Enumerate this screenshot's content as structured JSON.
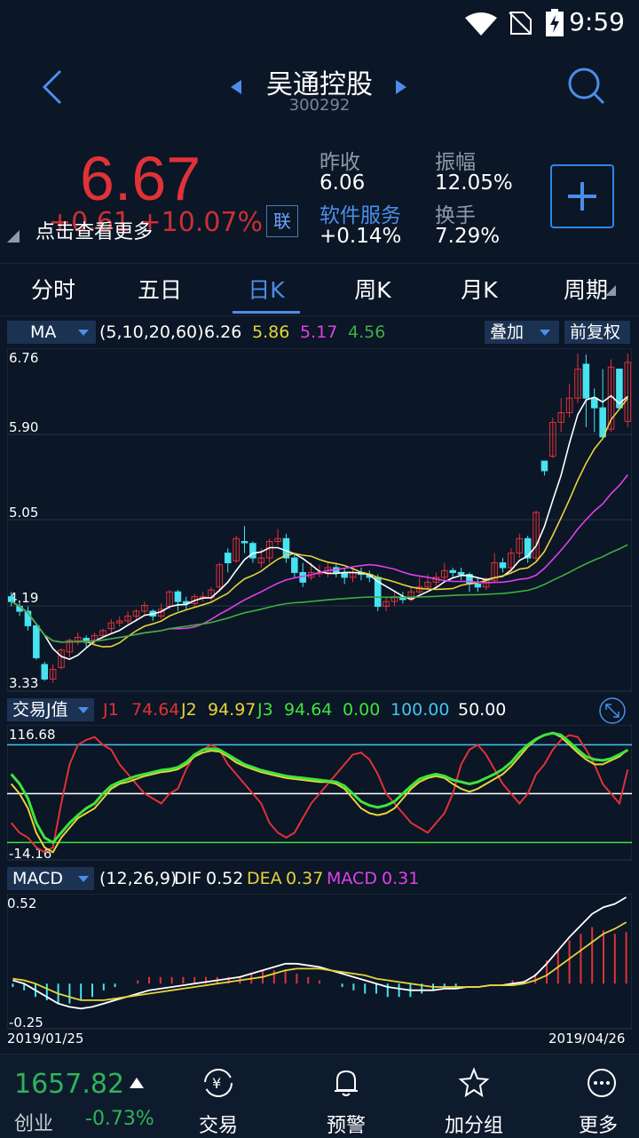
{
  "status": {
    "time": "9:59"
  },
  "header": {
    "title": "吴通控股",
    "code": "300292"
  },
  "quote": {
    "price": "6.67",
    "change": "+0.61  +10.07%",
    "hint": "点击查看更多",
    "lian": "联",
    "prev_close_label": "昨收",
    "prev_close": "6.06",
    "amplitude_label": "振幅",
    "amplitude": "12.05%",
    "sector_label": "软件服务",
    "sector_change": "+0.14%",
    "turnover_label": "换手",
    "turnover": "7.29%"
  },
  "tabs": [
    "分时",
    "五日",
    "日K",
    "周K",
    "月K",
    "周期"
  ],
  "ma": {
    "label": "MA",
    "params": "(5,10,20,60)",
    "v1": "6.26",
    "v2": "5.86",
    "v3": "5.17",
    "v4": "4.56",
    "overlay": "叠加",
    "adjust": "前复权",
    "y_labels": [
      "6.76",
      "5.90",
      "5.05",
      "4.19",
      "3.33"
    ]
  },
  "j": {
    "label": "交易J值",
    "j1_label": "J1",
    "j1": "74.64",
    "j2_label": "J2",
    "j2": "94.97",
    "j3_label": "J3",
    "j3": "94.64",
    "a": "0.00",
    "b": "100.00",
    "c": "50.00",
    "y_top": "116.68",
    "y_bottom": "-14.16"
  },
  "macd": {
    "label": "MACD",
    "params": "(12,26,9)",
    "dif_label": "DIF",
    "dif": "0.52",
    "dea_label": "DEA",
    "dea": "0.37",
    "macd_label": "MACD",
    "macd": "0.31",
    "y_top": "0.52",
    "y_bottom": "-0.25",
    "date_start": "2019/01/25",
    "date_end": "2019/04/26"
  },
  "bottom": {
    "index_value": "1657.82",
    "index_name": "创业",
    "index_change": "-0.73%",
    "trade": "交易",
    "alert": "预警",
    "watchlist": "加分组",
    "more": "更多"
  },
  "colors": {
    "up": "#e03238",
    "down": "#2fb35a",
    "cyan": "#46e3f0",
    "accent": "#4b8ee9"
  },
  "chart_data": [
    {
      "type": "candlestick",
      "title": "",
      "ylim": [
        3.33,
        6.76
      ],
      "candles": [
        [
          4.25,
          4.2,
          4.3,
          4.15
        ],
        [
          4.15,
          4.1,
          4.2,
          4.05
        ],
        [
          4.1,
          3.95,
          4.15,
          3.9
        ],
        [
          3.95,
          3.62,
          3.98,
          3.6
        ],
        [
          3.55,
          3.4,
          3.58,
          3.38
        ],
        [
          3.4,
          3.5,
          3.55,
          3.36
        ],
        [
          3.52,
          3.7,
          3.72,
          3.5
        ],
        [
          3.68,
          3.8,
          3.82,
          3.62
        ],
        [
          3.78,
          3.83,
          3.88,
          3.75
        ],
        [
          3.82,
          3.78,
          3.85,
          3.72
        ],
        [
          3.8,
          3.85,
          3.88,
          3.76
        ],
        [
          3.85,
          3.9,
          3.92,
          3.82
        ],
        [
          3.92,
          3.98,
          4.02,
          3.88
        ],
        [
          3.98,
          4.0,
          4.05,
          3.94
        ],
        [
          4.0,
          4.05,
          4.1,
          3.97
        ],
        [
          4.05,
          4.1,
          4.12,
          4.0
        ],
        [
          4.1,
          4.16,
          4.2,
          4.05
        ],
        [
          4.1,
          4.05,
          4.12,
          4.0
        ],
        [
          4.05,
          4.12,
          4.18,
          4.02
        ],
        [
          4.15,
          4.3,
          4.32,
          4.12
        ],
        [
          4.3,
          4.2,
          4.32,
          4.1
        ],
        [
          4.2,
          4.18,
          4.25,
          4.12
        ],
        [
          4.18,
          4.25,
          4.28,
          4.15
        ],
        [
          4.25,
          4.25,
          4.3,
          4.2
        ],
        [
          4.24,
          4.32,
          4.35,
          4.2
        ],
        [
          4.35,
          4.58,
          4.6,
          4.3
        ],
        [
          4.7,
          4.6,
          4.75,
          4.5
        ],
        [
          4.62,
          4.85,
          4.88,
          4.6
        ],
        [
          4.82,
          4.81,
          4.98,
          4.7
        ],
        [
          4.8,
          4.65,
          4.82,
          4.6
        ],
        [
          4.6,
          4.65,
          4.75,
          4.55
        ],
        [
          4.65,
          4.82,
          4.85,
          4.6
        ],
        [
          4.82,
          4.85,
          4.95,
          4.78
        ],
        [
          4.85,
          4.65,
          4.9,
          4.6
        ],
        [
          4.65,
          4.5,
          4.7,
          4.45
        ],
        [
          4.5,
          4.4,
          4.6,
          4.35
        ],
        [
          4.45,
          4.5,
          4.6,
          4.42
        ],
        [
          4.5,
          4.5,
          4.58,
          4.45
        ],
        [
          4.5,
          4.55,
          4.6,
          4.45
        ],
        [
          4.55,
          4.5,
          4.6,
          4.45
        ],
        [
          4.5,
          4.45,
          4.55,
          4.38
        ],
        [
          4.45,
          4.5,
          4.55,
          4.4
        ],
        [
          4.5,
          4.48,
          4.55,
          4.42
        ],
        [
          4.48,
          4.45,
          4.52,
          4.4
        ],
        [
          4.45,
          4.15,
          4.48,
          4.1
        ],
        [
          4.15,
          4.2,
          4.25,
          4.1
        ],
        [
          4.2,
          4.25,
          4.3,
          4.15
        ],
        [
          4.25,
          4.22,
          4.3,
          4.18
        ],
        [
          4.22,
          4.3,
          4.35,
          4.2
        ],
        [
          4.3,
          4.35,
          4.45,
          4.28
        ],
        [
          4.35,
          4.4,
          4.48,
          4.32
        ],
        [
          4.4,
          4.45,
          4.5,
          4.35
        ],
        [
          4.45,
          4.52,
          4.6,
          4.4
        ],
        [
          4.52,
          4.5,
          4.55,
          4.45
        ],
        [
          4.5,
          4.48,
          4.55,
          4.42
        ],
        [
          4.48,
          4.38,
          4.5,
          4.3
        ],
        [
          4.38,
          4.35,
          4.45,
          4.3
        ],
        [
          4.35,
          4.42,
          4.45,
          4.32
        ],
        [
          4.42,
          4.6,
          4.7,
          4.4
        ],
        [
          4.6,
          4.55,
          4.65,
          4.5
        ],
        [
          4.55,
          4.7,
          4.75,
          4.5
        ],
        [
          4.7,
          4.85,
          4.9,
          4.65
        ],
        [
          4.85,
          4.65,
          4.88,
          4.6
        ],
        [
          4.65,
          5.12,
          5.14,
          4.62
        ],
        [
          5.65,
          5.55,
          5.62,
          5.5
        ],
        [
          5.7,
          6.05,
          6.1,
          5.68
        ],
        [
          6.05,
          6.15,
          6.3,
          5.95
        ],
        [
          6.15,
          6.3,
          6.45,
          6.1
        ],
        [
          6.3,
          6.6,
          6.76,
          6.25
        ],
        [
          6.65,
          6.3,
          6.75,
          6.0
        ],
        [
          6.3,
          6.2,
          6.4,
          5.95
        ],
        [
          6.2,
          5.9,
          6.6,
          5.88
        ],
        [
          5.98,
          6.62,
          6.7,
          5.95
        ],
        [
          6.6,
          6.2,
          6.6,
          6.2
        ],
        [
          6.06,
          6.67,
          6.76,
          6.0
        ]
      ]
    },
    {
      "type": "line",
      "title": "",
      "ylim": [
        -14.16,
        116.68
      ],
      "series": [
        {
          "name": "J1",
          "values": [
            20,
            10,
            5,
            -5,
            -10,
            -5,
            40,
            80,
            100,
            105,
            108,
            100,
            95,
            80,
            70,
            60,
            50,
            45,
            40,
            50,
            55,
            75,
            90,
            95,
            100,
            95,
            80,
            70,
            60,
            50,
            40,
            20,
            10,
            5,
            10,
            25,
            40,
            50,
            60,
            70,
            80,
            90,
            92,
            85,
            70,
            50,
            40,
            30,
            20,
            15,
            10,
            20,
            30,
            50,
            80,
            95,
            100,
            90,
            75,
            60,
            50,
            40,
            50,
            70,
            80,
            95,
            105,
            110,
            108,
            95,
            80,
            60,
            50,
            40,
            74.64
          ]
        },
        {
          "name": "J2",
          "values": [
            60,
            50,
            35,
            10,
            -5,
            -10,
            5,
            15,
            25,
            30,
            35,
            45,
            55,
            60,
            62,
            65,
            68,
            70,
            72,
            73,
            75,
            80,
            88,
            92,
            94,
            93,
            88,
            82,
            78,
            75,
            72,
            70,
            68,
            66,
            65,
            64,
            63,
            62,
            62,
            60,
            55,
            45,
            35,
            30,
            28,
            30,
            35,
            45,
            55,
            62,
            66,
            68,
            66,
            60,
            55,
            52,
            55,
            60,
            65,
            70,
            78,
            88,
            98,
            105,
            110,
            112,
            108,
            100,
            92,
            85,
            80,
            80,
            84,
            88,
            94.97
          ]
        },
        {
          "name": "J3",
          "values": [
            70,
            60,
            45,
            20,
            5,
            0,
            10,
            20,
            28,
            35,
            40,
            50,
            58,
            62,
            65,
            68,
            70,
            72,
            74,
            75,
            77,
            82,
            90,
            95,
            96,
            95,
            90,
            85,
            80,
            77,
            74,
            72,
            70,
            68,
            67,
            66,
            65,
            64,
            63,
            62,
            58,
            50,
            42,
            38,
            36,
            38,
            42,
            50,
            58,
            65,
            68,
            70,
            68,
            64,
            62,
            60,
            62,
            66,
            70,
            75,
            82,
            92,
            100,
            106,
            110,
            112,
            110,
            103,
            95,
            88,
            85,
            84,
            86,
            90,
            94.64
          ]
        }
      ]
    },
    {
      "type": "bar+line",
      "title": "",
      "ylim": [
        -0.25,
        0.52
      ],
      "series": [
        {
          "name": "DIF",
          "values": [
            0.02,
            0.0,
            -0.04,
            -0.08,
            -0.12,
            -0.14,
            -0.15,
            -0.14,
            -0.12,
            -0.1,
            -0.08,
            -0.06,
            -0.04,
            -0.03,
            -0.02,
            -0.01,
            0.0,
            0.01,
            0.02,
            0.03,
            0.04,
            0.06,
            0.08,
            0.1,
            0.12,
            0.12,
            0.11,
            0.1,
            0.08,
            0.06,
            0.04,
            0.02,
            0.0,
            -0.02,
            -0.03,
            -0.04,
            -0.04,
            -0.04,
            -0.03,
            -0.03,
            -0.02,
            -0.02,
            -0.01,
            -0.01,
            0.0,
            0.01,
            0.05,
            0.12,
            0.2,
            0.28,
            0.35,
            0.42,
            0.46,
            0.48,
            0.52
          ]
        },
        {
          "name": "DEA",
          "values": [
            0.03,
            0.02,
            0.0,
            -0.03,
            -0.06,
            -0.08,
            -0.1,
            -0.1,
            -0.1,
            -0.09,
            -0.08,
            -0.07,
            -0.06,
            -0.05,
            -0.04,
            -0.03,
            -0.02,
            -0.01,
            0.0,
            0.01,
            0.02,
            0.03,
            0.04,
            0.06,
            0.08,
            0.09,
            0.09,
            0.09,
            0.08,
            0.07,
            0.06,
            0.05,
            0.03,
            0.02,
            0.01,
            0.0,
            -0.01,
            -0.02,
            -0.02,
            -0.02,
            -0.02,
            -0.02,
            -0.01,
            -0.01,
            -0.01,
            0.0,
            0.02,
            0.05,
            0.1,
            0.15,
            0.2,
            0.25,
            0.3,
            0.33,
            0.37
          ]
        },
        {
          "name": "MACD",
          "values": [
            -0.02,
            -0.04,
            -0.08,
            -0.1,
            -0.12,
            -0.12,
            -0.1,
            -0.08,
            -0.04,
            -0.02,
            0.0,
            0.02,
            0.04,
            0.04,
            0.04,
            0.04,
            0.04,
            0.04,
            0.04,
            0.04,
            0.04,
            0.06,
            0.08,
            0.08,
            0.08,
            0.06,
            0.04,
            0.02,
            0.0,
            -0.02,
            -0.04,
            -0.06,
            -0.06,
            -0.08,
            -0.08,
            -0.08,
            -0.06,
            -0.04,
            -0.02,
            -0.02,
            0.0,
            0.0,
            0.0,
            0.0,
            0.02,
            0.02,
            0.06,
            0.14,
            0.2,
            0.26,
            0.3,
            0.34,
            0.32,
            0.3,
            0.31
          ]
        }
      ]
    }
  ]
}
